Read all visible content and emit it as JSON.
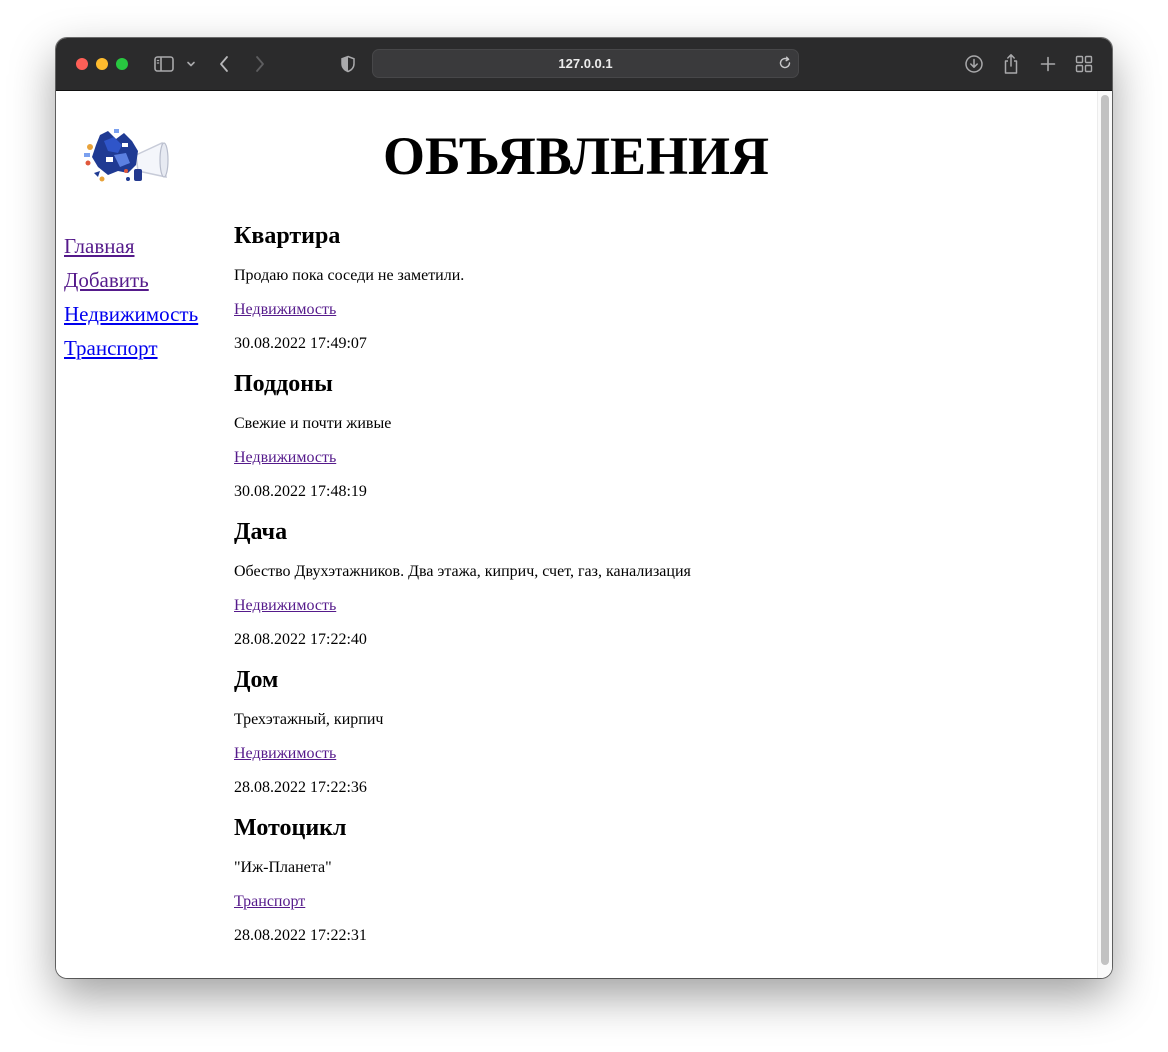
{
  "browser": {
    "url": "127.0.0.1"
  },
  "page": {
    "title": "ОБЪЯВЛЕНИЯ"
  },
  "sidebar": {
    "items": [
      {
        "label": "Главная"
      },
      {
        "label": "Добавить"
      },
      {
        "label": "Недвижимость"
      },
      {
        "label": "Транспорт"
      }
    ]
  },
  "ads": [
    {
      "title": "Квартира",
      "description": "Продаю пока соседи не заметили.",
      "category": "Недвижимость",
      "date": "30.08.2022 17:49:07"
    },
    {
      "title": "Поддоны",
      "description": "Свежие и почти живые",
      "category": "Недвижимость",
      "date": "30.08.2022 17:48:19"
    },
    {
      "title": "Дача",
      "description": "Обество Двухэтажников. Два этажа, киприч, счет, газ, канализация",
      "category": "Недвижимость",
      "date": "28.08.2022 17:22:40"
    },
    {
      "title": "Дом",
      "description": "Трехэтажный, кирпич",
      "category": "Недвижимость",
      "date": "28.08.2022 17:22:36"
    },
    {
      "title": "Мотоцикл",
      "description": "\"Иж-Планета\"",
      "category": "Транспорт",
      "date": "28.08.2022 17:22:31"
    }
  ]
}
